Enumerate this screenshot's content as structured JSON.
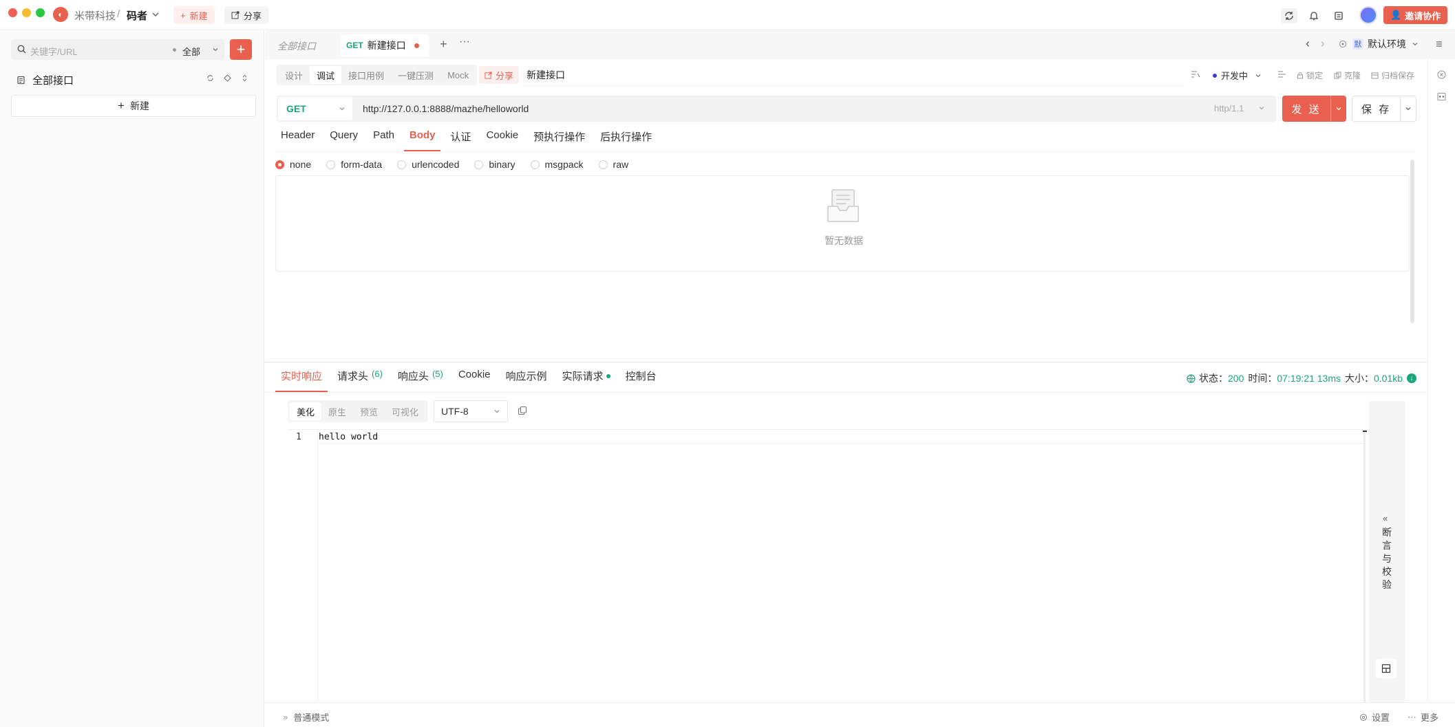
{
  "topbar": {
    "org": "米带科技",
    "separator": "/",
    "project": "码者",
    "new_label": "新建",
    "share_label": "分享",
    "invite_label": "邀请协作",
    "window_dots": [
      "#ee5f57",
      "#f5bd2f",
      "#28c840"
    ]
  },
  "sidebar": {
    "search_placeholder": "关键字/URL",
    "filter_label": "全部",
    "tree_root": "全部接口",
    "new_item": "新建"
  },
  "tabs": {
    "all": "全部接口",
    "active_method": "GET",
    "active_name": "新建接口",
    "env_badge": "默",
    "env_label": "默认环境"
  },
  "subbar": {
    "segments": [
      "设计",
      "调试",
      "接口用例",
      "一键压测",
      "Mock"
    ],
    "active_segment": "调试",
    "share": "分享",
    "api_name": "新建接口",
    "status": "开发中",
    "actions": [
      "锁定",
      "克隆",
      "归档保存"
    ]
  },
  "request": {
    "method": "GET",
    "url": "http://127.0.0.1:8888/mazhe/helloworld",
    "protocol": "http/1.1",
    "send_label": "发 送",
    "save_label": "保 存",
    "param_tabs": [
      "Header",
      "Query",
      "Path",
      "Body",
      "认证",
      "Cookie",
      "预执行操作",
      "后执行操作"
    ],
    "active_param_tab": "Body",
    "body_modes": [
      "none",
      "form-data",
      "urlencoded",
      "binary",
      "msgpack",
      "raw"
    ],
    "active_body_mode": "none",
    "empty_text": "暂无数据"
  },
  "response": {
    "tabs": [
      "实时响应",
      "请求头",
      "响应头",
      "Cookie",
      "响应示例",
      "实际请求",
      "控制台"
    ],
    "req_header_count": "(6)",
    "resp_header_count": "(5)",
    "status_label": "状态：",
    "status_code": "200",
    "time_label": "时间：",
    "time_value": "07:19:21 13ms",
    "size_label": "大小：",
    "size_value": "0.01kb",
    "view_modes": [
      "美化",
      "原生",
      "预览",
      "可视化"
    ],
    "encoding": "UTF-8",
    "line_number": "1",
    "body": "hello world",
    "assert_label": "断言与校验"
  },
  "footer": {
    "mode": "普通模式",
    "settings": "设置",
    "more": "更多"
  },
  "colors": {
    "accent": "#e9604f",
    "get_method": "#1aa57a"
  }
}
